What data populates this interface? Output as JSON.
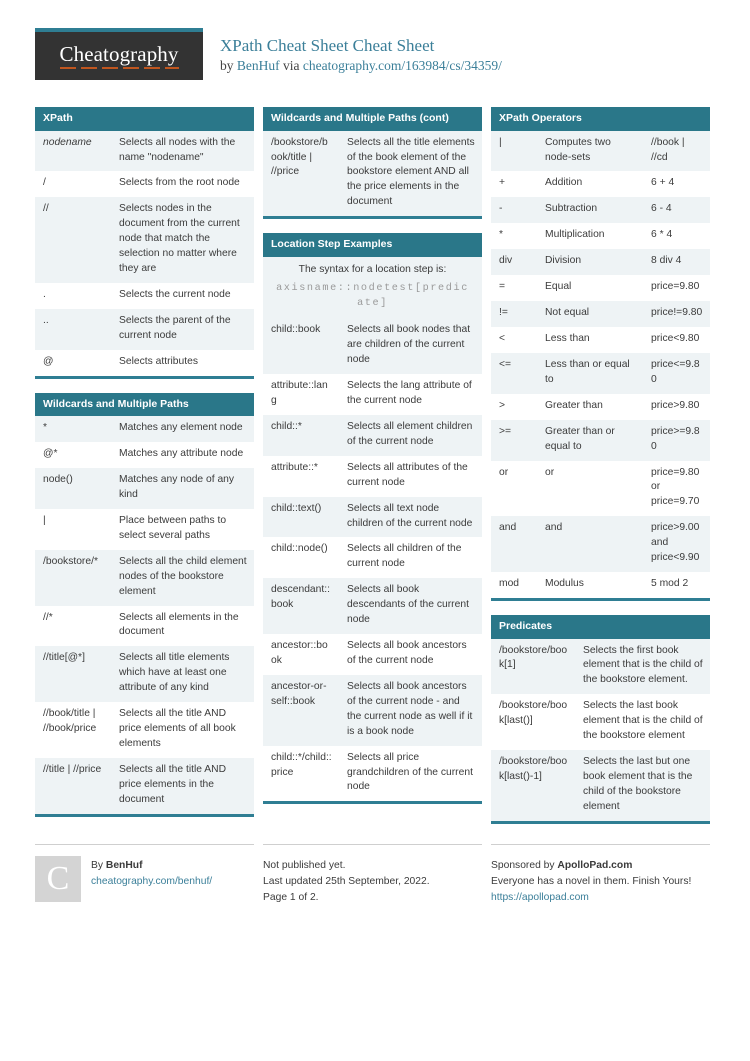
{
  "header": {
    "logo_text": "Cheatography",
    "title": "XPath Cheat Sheet Cheat Sheet",
    "by_prefix": "by ",
    "author": "BenHuf",
    "via": " via ",
    "source_url": "cheatography.com/163984/cs/34359/"
  },
  "colors": {
    "header_teal": "#2a7789",
    "accent_bar": "#2f7e93",
    "link": "#3b7f99",
    "row_stripe": "#eef3f5",
    "logo_bg": "#333333",
    "logo_underline": "#c0561f",
    "avatar_bg": "#d4d4d4"
  },
  "cards": {
    "xpath": {
      "title": "XPath",
      "rows": [
        {
          "k": "nodename",
          "k_italic": true,
          "v": "Selects all nodes with the name \"nodename\""
        },
        {
          "k": "/",
          "v": "Selects from the root node"
        },
        {
          "k": "//",
          "v": "Selects nodes in the document from the current node that match the selection no matter where they are"
        },
        {
          "k": ".",
          "v": "Selects the current node"
        },
        {
          "k": "..",
          "v": "Selects the parent of the current node"
        },
        {
          "k": "@",
          "v": "Selects attributes"
        }
      ]
    },
    "wildcards": {
      "title": "Wildcards and Multiple Paths",
      "rows": [
        {
          "k": "*",
          "v": "Matches any element node"
        },
        {
          "k": "@*",
          "v": "Matches any attribute node"
        },
        {
          "k": "node()",
          "v": "Matches any node of any kind"
        },
        {
          "k": "|",
          "v": "Place between paths to select several paths"
        },
        {
          "k": "/bookstore/*",
          "v": "Selects all the child element nodes of the bookstore element"
        },
        {
          "k": "//*",
          "v": "Selects all elements in the document"
        },
        {
          "k": "//title[@*]",
          "v": "Selects all title elements which have at least one attribute of any kind"
        },
        {
          "k": "//book/title | //book/price",
          "v": "Selects all the title AND price elements of all book elements"
        },
        {
          "k": "//title | //price",
          "v": "Selects all the title AND price elements in the document"
        }
      ]
    },
    "wildcards_cont": {
      "title": "Wildcards and Multiple Paths (cont)",
      "rows": [
        {
          "k": "/bookstore/book/title | //price",
          "v": "Selects all the title elements of the book element of the bookstore element AND all the price elements in the document"
        }
      ]
    },
    "location_steps": {
      "title": "Location Step Examples",
      "syntax_note": "The syntax for a location step is:",
      "syntax_code": "axisname::nodetest[predicate]",
      "rows": [
        {
          "k": "child::book",
          "v": "Selects all book nodes that are children of the current node"
        },
        {
          "k": "attribute::lang",
          "v": "Selects the lang attribute of the current node"
        },
        {
          "k": "child::*",
          "v": "Selects all element children of the current node"
        },
        {
          "k": "attribute::*",
          "v": "Selects all attributes of the current node"
        },
        {
          "k": "child::text()",
          "v": "Selects all text node children of the current node"
        },
        {
          "k": "child::node()",
          "v": "Selects all children of the current node"
        },
        {
          "k": "descendant::book",
          "v": "Selects all book descendants of the current node"
        },
        {
          "k": "ancestor::book",
          "v": "Selects all book ancestors of the current node"
        },
        {
          "k": "ancestor-or-self::book",
          "v": "Selects all book ancestors of the current node - and the current node as well if it is a book node"
        },
        {
          "k": "child::*/child::price",
          "v": "Selects all price grandchildren of the current node"
        }
      ]
    },
    "operators": {
      "title": "XPath Operators",
      "rows": [
        {
          "k": "|",
          "v": "Computes two node-sets",
          "ex": "//book | //cd"
        },
        {
          "k": "+",
          "v": "Addition",
          "ex": "6 + 4"
        },
        {
          "k": "-",
          "v": "Subtraction",
          "ex": "6 - 4"
        },
        {
          "k": "*",
          "v": "Multiplication",
          "ex": "6 * 4"
        },
        {
          "k": "div",
          "v": "Division",
          "ex": "8 div 4"
        },
        {
          "k": "=",
          "v": "Equal",
          "ex": "price=9.80"
        },
        {
          "k": "!=",
          "v": "Not equal",
          "ex": "price!=9.80"
        },
        {
          "k": "<",
          "v": "Less than",
          "ex": "price<9.80"
        },
        {
          "k": "<=",
          "v": "Less than or equal to",
          "ex": "price<=9.80"
        },
        {
          "k": ">",
          "v": "Greater than",
          "ex": "price>9.80"
        },
        {
          "k": ">=",
          "v": "Greater than or equal to",
          "ex": "price>=9.80"
        },
        {
          "k": "or",
          "v": "or",
          "ex": "price=9.80 or price=9.70"
        },
        {
          "k": "and",
          "v": "and",
          "ex": "price>9.00 and price<9.90"
        },
        {
          "k": "mod",
          "v": "Modulus",
          "ex": "5 mod 2"
        }
      ]
    },
    "predicates": {
      "title": "Predicates",
      "rows": [
        {
          "k": "/bookstore/book[1]",
          "v": "Selects the first book element that is the child of the bookstore element."
        },
        {
          "k": "/bookstore/book[last()]",
          "v": "Selects the last book element that is the child of the bookstore element"
        },
        {
          "k": "/bookstore/book[last()-1]",
          "v": "Selects the last but one book element that is the child of the bookstore element"
        }
      ]
    }
  },
  "footer": {
    "author_block": {
      "avatar_letter": "C",
      "by_label": "By ",
      "author": "BenHuf",
      "profile_url": "cheatography.com/benhuf/"
    },
    "publish_block": {
      "line1": "Not published yet.",
      "line2": "Last updated 25th September, 2022.",
      "line3": "Page 1 of 2."
    },
    "sponsor_block": {
      "sponsor_prefix": "Sponsored by ",
      "sponsor_name": "ApolloPad.com",
      "tagline": "Everyone has a novel in them. Finish Yours!",
      "sponsor_url": "https://apollopad.com"
    }
  }
}
